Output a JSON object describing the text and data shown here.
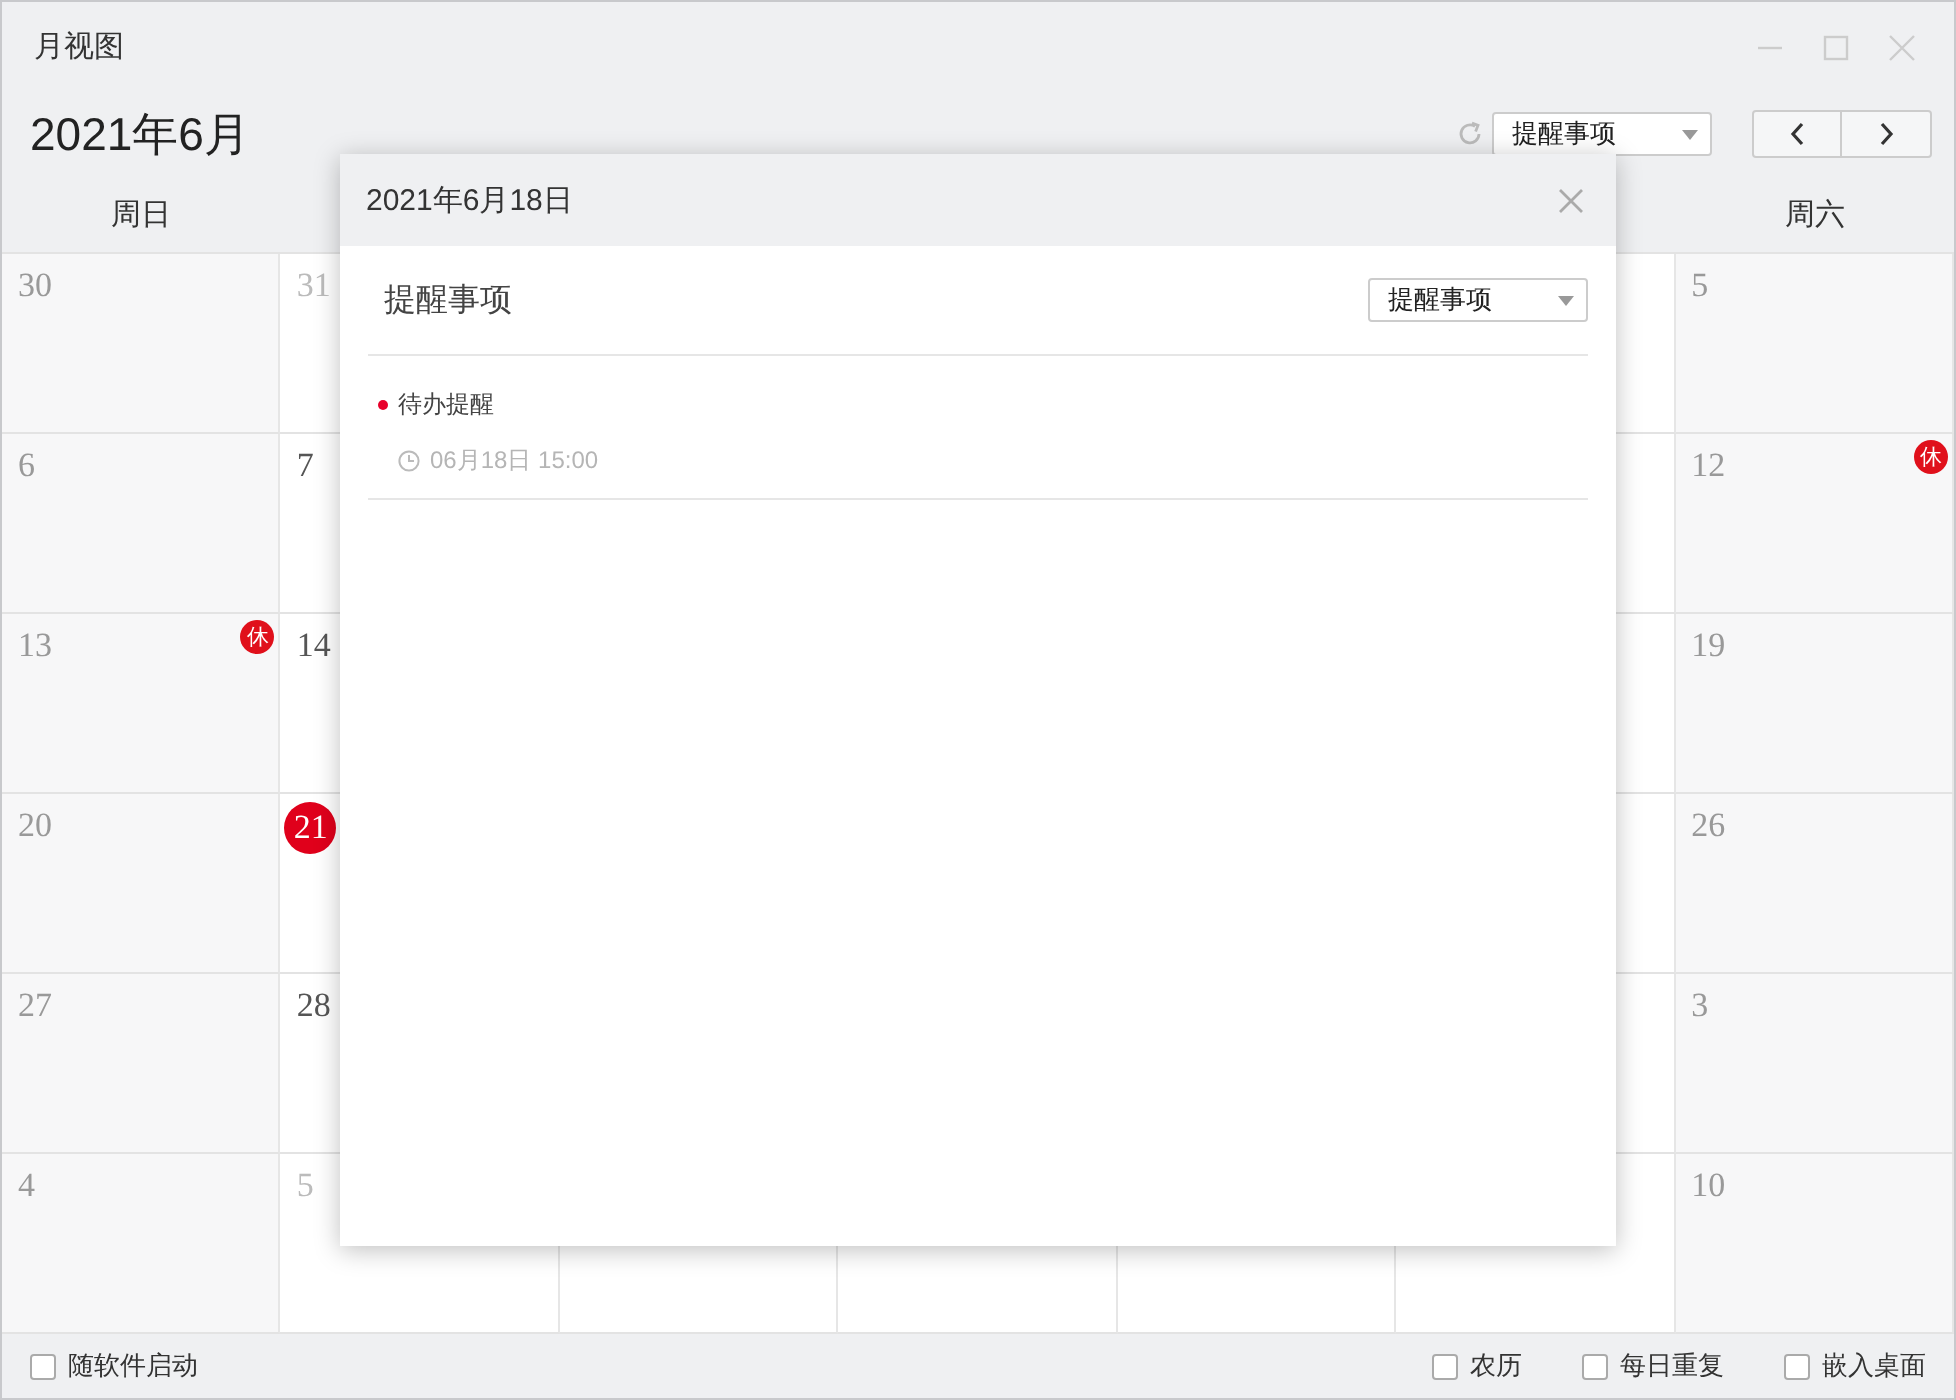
{
  "window": {
    "title": "月视图"
  },
  "toolbar": {
    "month": "2021年6月",
    "filter": {
      "value": "提醒事项"
    }
  },
  "weekdays": [
    {
      "label": "周日",
      "kind": "first"
    },
    {
      "label": "周六",
      "kind": "last"
    }
  ],
  "weeks": [
    {
      "cells": [
        {
          "kind": "weekend",
          "day": "30"
        },
        {
          "kind": "weekday",
          "day": "31",
          "other_month": true
        },
        {
          "kind": "weekday"
        },
        {
          "kind": "weekday"
        },
        {
          "kind": "weekday"
        },
        {
          "kind": "weekday"
        },
        {
          "kind": "weekend",
          "day": "5"
        }
      ]
    },
    {
      "cells": [
        {
          "kind": "weekend",
          "day": "6"
        },
        {
          "kind": "weekday",
          "day": "7",
          "other_month": false
        },
        {
          "kind": "weekday"
        },
        {
          "kind": "weekday"
        },
        {
          "kind": "weekday"
        },
        {
          "kind": "weekday"
        },
        {
          "kind": "weekend",
          "day": "12",
          "badge": "休"
        }
      ]
    },
    {
      "cells": [
        {
          "kind": "weekend",
          "day": "13",
          "badge": "休"
        },
        {
          "kind": "weekday",
          "day": "14",
          "other_month": false
        },
        {
          "kind": "weekday"
        },
        {
          "kind": "weekday"
        },
        {
          "kind": "weekday"
        },
        {
          "kind": "weekday"
        },
        {
          "kind": "weekend",
          "day": "19"
        }
      ]
    },
    {
      "cells": [
        {
          "kind": "weekend",
          "day": "20"
        },
        {
          "kind": "weekday",
          "day": "21",
          "today": true
        },
        {
          "kind": "weekday"
        },
        {
          "kind": "weekday"
        },
        {
          "kind": "weekday"
        },
        {
          "kind": "weekday"
        },
        {
          "kind": "weekend",
          "day": "26"
        }
      ]
    },
    {
      "cells": [
        {
          "kind": "weekend",
          "day": "27"
        },
        {
          "kind": "weekday",
          "day": "28",
          "other_month": false
        },
        {
          "kind": "weekday"
        },
        {
          "kind": "weekday"
        },
        {
          "kind": "weekday"
        },
        {
          "kind": "weekday"
        },
        {
          "kind": "weekend",
          "day": "3"
        }
      ]
    },
    {
      "cells": [
        {
          "kind": "weekend",
          "day": "4"
        },
        {
          "kind": "weekday",
          "day": "5",
          "other_month": true
        },
        {
          "kind": "weekday"
        },
        {
          "kind": "weekday"
        },
        {
          "kind": "weekday"
        },
        {
          "kind": "weekday"
        },
        {
          "kind": "weekend",
          "day": "10"
        }
      ]
    }
  ],
  "dialog": {
    "title": "2021年6月18日",
    "section_title": "提醒事项",
    "filter": {
      "value": "提醒事项"
    },
    "items": [
      {
        "title": "待办提醒",
        "time": "06月18日 15:00",
        "color": "#e8002a"
      }
    ]
  },
  "footer": {
    "left": [
      {
        "label": "随软件启动",
        "checked": false
      }
    ],
    "right": [
      {
        "label": "农历",
        "checked": false
      },
      {
        "label": "每日重复",
        "checked": false
      },
      {
        "label": "嵌入桌面",
        "checked": false
      }
    ]
  }
}
